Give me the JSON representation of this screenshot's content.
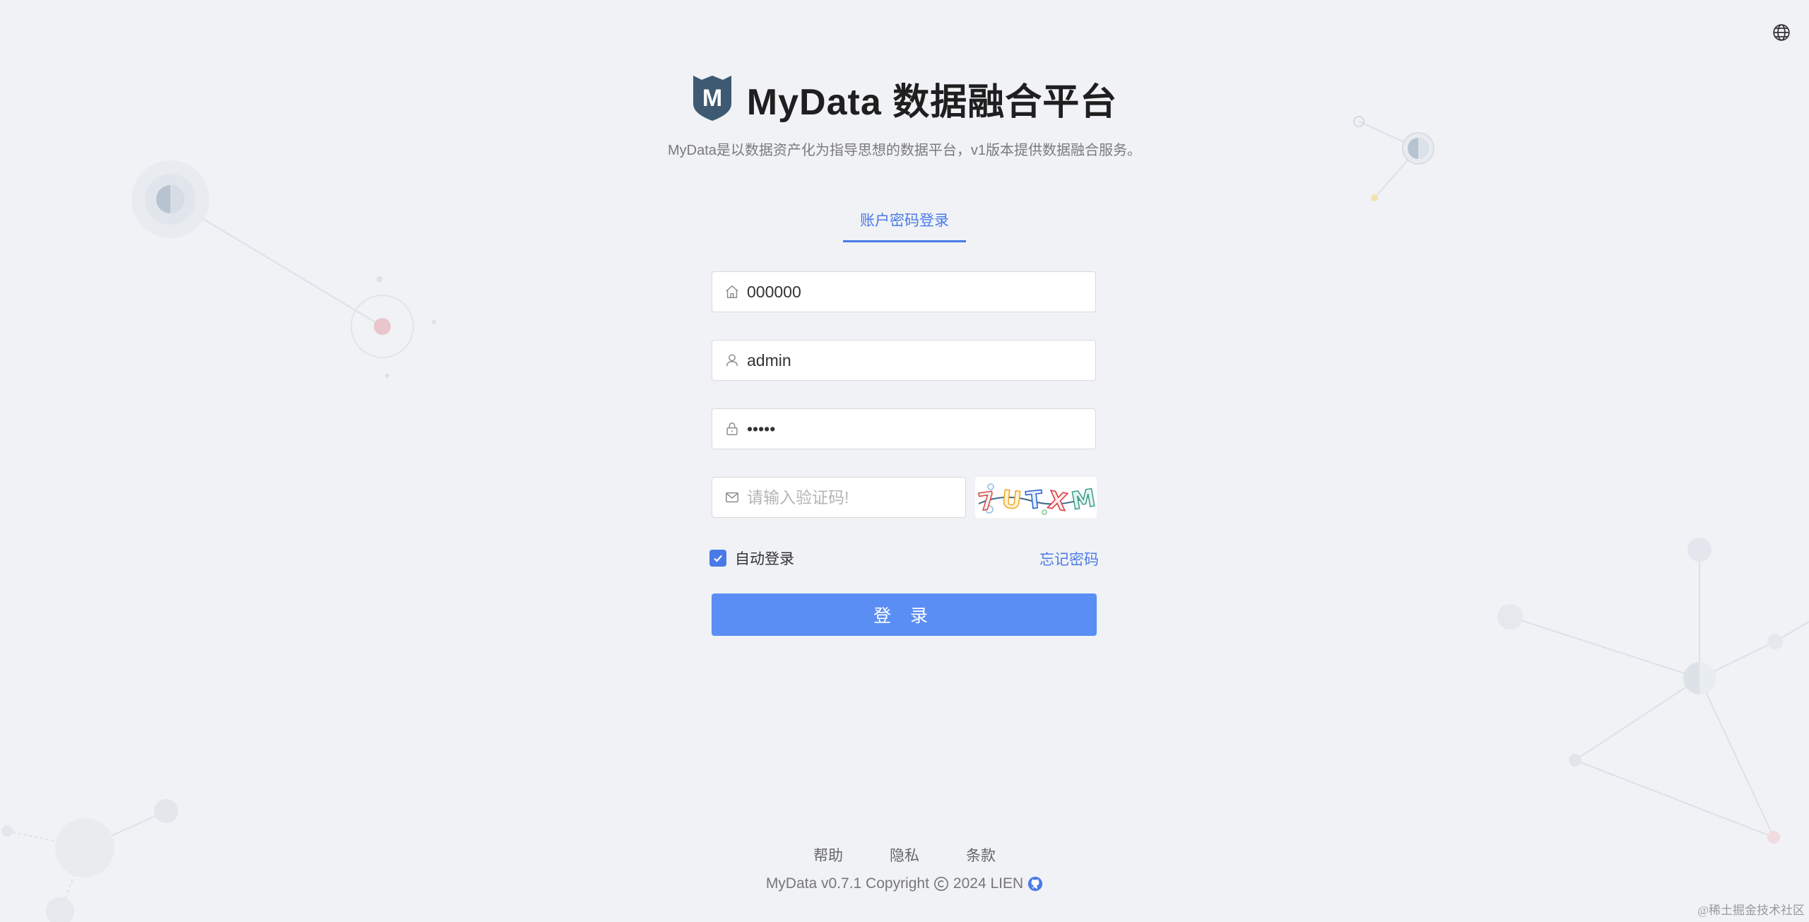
{
  "header": {
    "app_title": "MyData 数据融合平台",
    "subtitle": "MyData是以数据资产化为指导思想的数据平台，v1版本提供数据融合服务。",
    "logo_letter": "M"
  },
  "tabs": [
    {
      "label": "账户密码登录",
      "active": true
    }
  ],
  "form": {
    "tenant": {
      "value": "000000",
      "icon": "home-icon"
    },
    "username": {
      "value": "admin",
      "icon": "user-icon"
    },
    "password": {
      "value": "admin",
      "icon": "lock-icon"
    },
    "captcha": {
      "value": "",
      "placeholder": "请输入验证码!",
      "icon": "mail-icon",
      "image_text": "7UTXM"
    },
    "remember_label": "自动登录",
    "remember_checked": true,
    "forgot_label": "忘记密码",
    "login_label": "登 录"
  },
  "footer": {
    "links": [
      "帮助",
      "隐私",
      "条款"
    ],
    "copyright": "MyData v0.7.1 Copyright",
    "year_owner": "2024 LIEN"
  },
  "watermark": "@稀土掘金技术社区",
  "colors": {
    "accent": "#4a7ae8",
    "button": "#5b8ef4",
    "background": "#f0f2f5",
    "logo": "#3d5a72"
  }
}
